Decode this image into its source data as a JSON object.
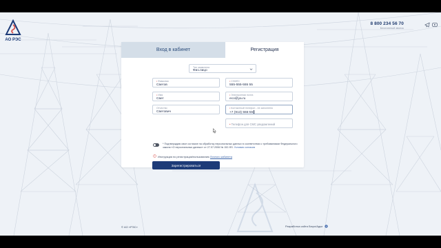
{
  "header": {
    "logo_text": "АО РЭС",
    "phone": "8 800 234 56 70",
    "phone_note": "Бесплатный звонок",
    "icons": [
      "telegram-icon",
      "youtube-icon"
    ]
  },
  "tabs": {
    "login": "Вход в кабинет",
    "register": "Регистрация"
  },
  "form": {
    "applicant_type": {
      "label": "Тип заявителя",
      "value": "Физ.лицо"
    },
    "last_name": {
      "label": "Фамилия",
      "value": "Светов"
    },
    "first_name": {
      "label": "Имя",
      "value": "Свет"
    },
    "patronymic": {
      "label": "Отчество",
      "value": "Светович"
    },
    "snils": {
      "label": "СНИЛС",
      "value": "555-555-555 55"
    },
    "email": {
      "label": "Электронная почта",
      "value": "eco@ya.ru"
    },
    "phone": {
      "label": "Контактный телефон - не заполнено",
      "value": "+7 (913) 555-55"
    },
    "sms_code": {
      "placeholder": "Телефон для СМС уведомлений"
    }
  },
  "consent": {
    "text": "* Подтверждаю свое согласие на обработку персональных данных в соответствии с требованиями Федерального закона «О персональных данных» от 27.07.2006 № 152-ФЗ.",
    "link": "Условия согласия"
  },
  "instruction": {
    "text": "Инструкция по регистрации/пользованию",
    "link": "Личного кабинета"
  },
  "buttons": {
    "register": "Зарегистрироваться"
  },
  "footer": {
    "copyright": "© АО «РЭС»",
    "developer": "Разработка сайта Бюро/Адыг"
  },
  "colors": {
    "primary": "#1d3b78",
    "tab_inactive": "#d4dee8",
    "background": "#eef2f7",
    "link": "#3a63a8",
    "required": "#d9534f"
  }
}
